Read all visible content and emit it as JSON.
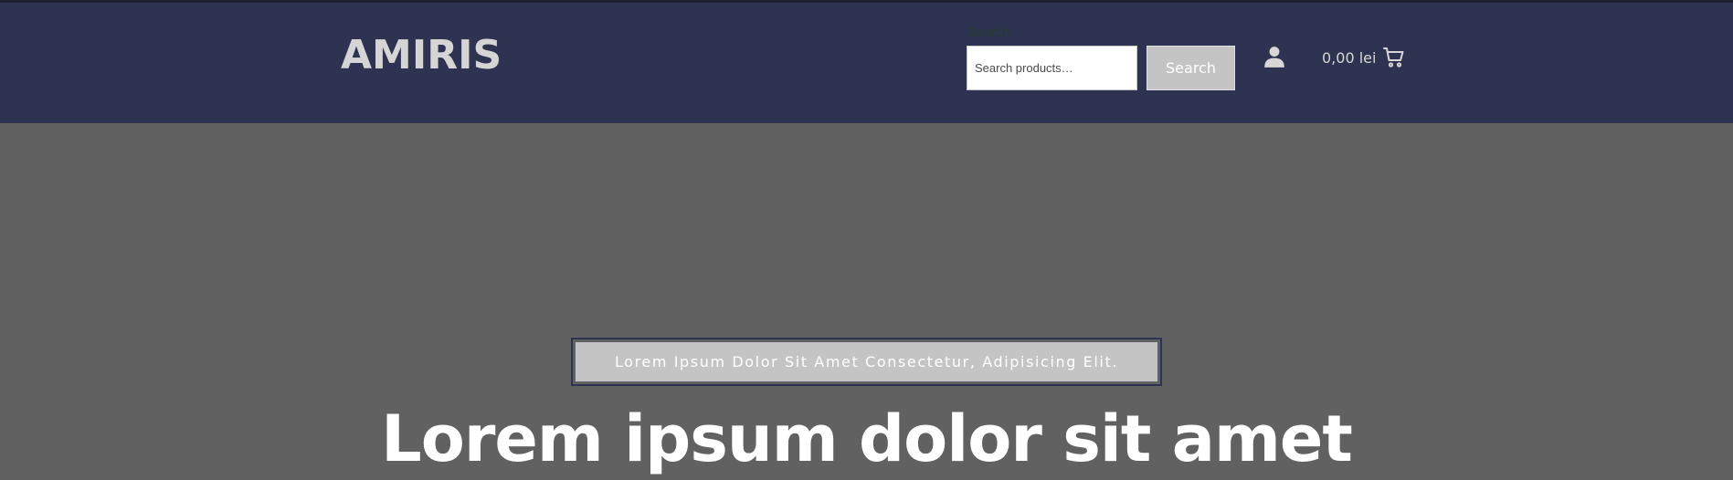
{
  "header": {
    "logo": "AMIRIS",
    "search": {
      "label": "Search",
      "placeholder": "Search products…",
      "value": "",
      "button_label": "Search"
    },
    "account_icon": "user-icon",
    "cart": {
      "amount": "0,00 lei",
      "icon": "cart-icon"
    }
  },
  "hero": {
    "tagline": "Lorem Ipsum Dolor Sit Amet Consectetur, Adipisicing Elit.",
    "title": "Lorem ipsum dolor sit amet"
  },
  "colors": {
    "header_bg": "#2d3350",
    "hero_bg": "#616161",
    "button_bg": "#c4c4c4"
  }
}
